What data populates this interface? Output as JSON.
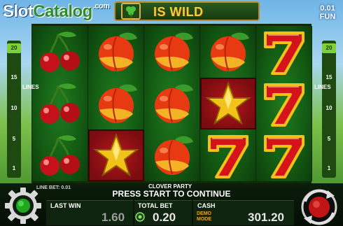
{
  "brand": {
    "part1": "Slot",
    "part2": "Catalog",
    "suffix": ".com"
  },
  "header": {
    "wild_text": "IS WILD"
  },
  "fun": {
    "amount": "0.01",
    "currency": "FUN"
  },
  "lines": {
    "label": "LINES",
    "numbers": [
      "20",
      "15",
      "10",
      "5",
      "1"
    ]
  },
  "reels": [
    [
      "cherry",
      "cherry",
      "cherry"
    ],
    [
      "peach",
      "peach",
      "star"
    ],
    [
      "peach",
      "peach",
      "peach"
    ],
    [
      "peach",
      "star",
      "seven"
    ],
    [
      "seven",
      "seven",
      "seven"
    ]
  ],
  "highlighted": [
    [
      1,
      2
    ],
    [
      3,
      1
    ]
  ],
  "footer": {
    "line_bet_label": "LINE BET: 0.01",
    "game_name": "CLOVER PARTY",
    "message": "PRESS START TO CONTINUE",
    "last_win_label": "LAST WIN",
    "last_win_value": "1.60",
    "total_bet_label": "TOTAL BET",
    "total_bet_value": "0.20",
    "cash_label": "CASH",
    "demo_mode": "DEMO MODE",
    "cash_value": "301.20"
  },
  "colors": {
    "accent_green": "#7fd13a",
    "wild_gold": "#f5cf3a",
    "demo_orange": "#f0a020",
    "cell_red": "#b6171b"
  }
}
